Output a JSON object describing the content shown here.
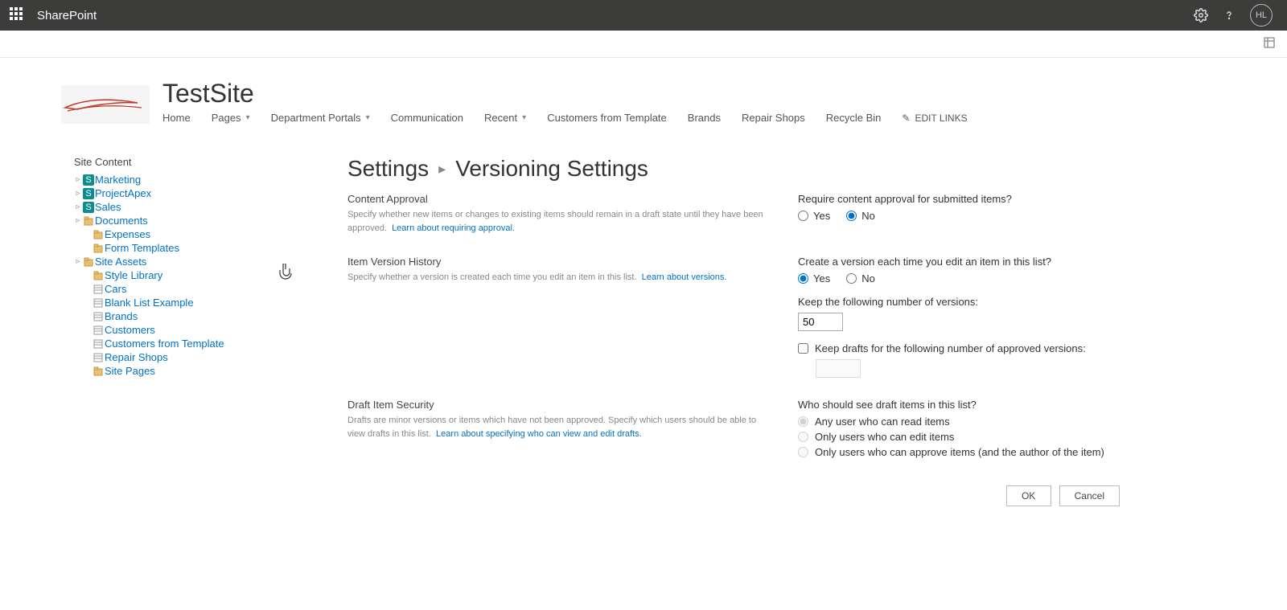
{
  "suite": {
    "app_name": "SharePoint",
    "avatar_initials": "HL"
  },
  "site": {
    "title": "TestSite"
  },
  "top_nav": {
    "items": [
      {
        "label": "Home",
        "has_dropdown": false
      },
      {
        "label": "Pages",
        "has_dropdown": true
      },
      {
        "label": "Department Portals",
        "has_dropdown": true
      },
      {
        "label": "Communication",
        "has_dropdown": false
      },
      {
        "label": "Recent",
        "has_dropdown": true
      },
      {
        "label": "Customers from Template",
        "has_dropdown": false
      },
      {
        "label": "Brands",
        "has_dropdown": false
      },
      {
        "label": "Repair Shops",
        "has_dropdown": false
      },
      {
        "label": "Recycle Bin",
        "has_dropdown": false
      }
    ],
    "edit_links_label": "EDIT LINKS"
  },
  "sidebar": {
    "title": "Site Content",
    "nodes": [
      {
        "label": "Marketing",
        "icon": "site",
        "expandable": true
      },
      {
        "label": "ProjectApex",
        "icon": "site",
        "expandable": true
      },
      {
        "label": "Sales",
        "icon": "site",
        "expandable": true
      },
      {
        "label": "Documents",
        "icon": "lib",
        "expandable": true
      },
      {
        "label": "Expenses",
        "icon": "lib",
        "expandable": false,
        "indent": true
      },
      {
        "label": "Form Templates",
        "icon": "lib",
        "expandable": false,
        "indent": true
      },
      {
        "label": "Site Assets",
        "icon": "lib",
        "expandable": true
      },
      {
        "label": "Style Library",
        "icon": "lib",
        "expandable": false,
        "indent": true
      },
      {
        "label": "Cars",
        "icon": "list",
        "expandable": false,
        "indent": true
      },
      {
        "label": "Blank List Example",
        "icon": "list",
        "expandable": false,
        "indent": true
      },
      {
        "label": "Brands",
        "icon": "list",
        "expandable": false,
        "indent": true
      },
      {
        "label": "Customers",
        "icon": "list",
        "expandable": false,
        "indent": true
      },
      {
        "label": "Customers from Template",
        "icon": "list",
        "expandable": false,
        "indent": true
      },
      {
        "label": "Repair Shops",
        "icon": "list",
        "expandable": false,
        "indent": true
      },
      {
        "label": "Site Pages",
        "icon": "lib",
        "expandable": false,
        "indent": true
      }
    ]
  },
  "breadcrumb": {
    "root": "Settings",
    "page": "Versioning Settings"
  },
  "sections": {
    "content_approval": {
      "title": "Content Approval",
      "desc": "Specify whether new items or changes to existing items should remain in a draft state until they have been approved.",
      "learn_link": "Learn about requiring approval.",
      "question": "Require content approval for submitted items?",
      "yes": "Yes",
      "no": "No",
      "selected": "no"
    },
    "version_history": {
      "title": "Item Version History",
      "desc": "Specify whether a version is created each time you edit an item in this list.",
      "learn_link": "Learn about versions.",
      "question": "Create a version each time you edit an item in this list?",
      "yes": "Yes",
      "no": "No",
      "selected": "yes",
      "keep_versions_label": "Keep the following number of versions:",
      "keep_versions_value": "50",
      "keep_drafts_label": "Keep drafts for the following number of approved versions:",
      "keep_drafts_value": ""
    },
    "draft_security": {
      "title": "Draft Item Security",
      "desc": "Drafts are minor versions or items which have not been approved. Specify which users should be able to view drafts in this list.",
      "learn_link": "Learn about specifying who can view and edit drafts.",
      "question": "Who should see draft items in this list?",
      "opt1": "Any user who can read items",
      "opt2": "Only users who can edit items",
      "opt3": "Only users who can approve items (and the author of the item)",
      "selected": "opt1"
    }
  },
  "buttons": {
    "ok": "OK",
    "cancel": "Cancel"
  }
}
